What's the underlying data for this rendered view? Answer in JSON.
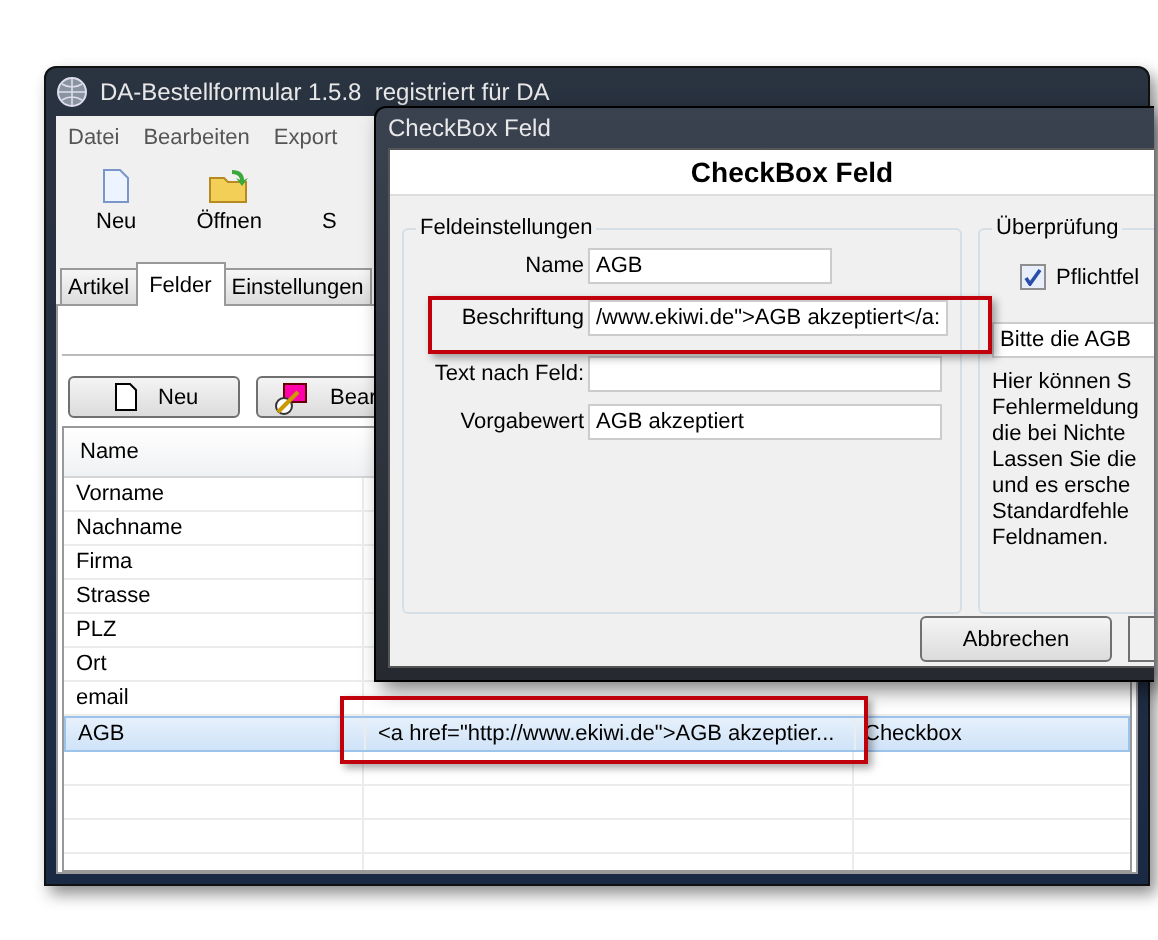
{
  "main_window": {
    "title": "DA-Bestellformular 1.5.8  registriert für DA",
    "menu": [
      "Datei",
      "Bearbeiten",
      "Export"
    ],
    "toolbar": [
      "Neu",
      "Öffnen",
      "S"
    ],
    "tabs": [
      {
        "label": "Artikel",
        "selected": false
      },
      {
        "label": "Felder",
        "selected": true
      },
      {
        "label": "Einstellungen",
        "selected": false
      }
    ],
    "buttons": [
      "Neu",
      "Bear"
    ],
    "table": {
      "columns": [
        "Name"
      ],
      "rows": [
        {
          "cells": [
            "Vorname"
          ],
          "selected": false
        },
        {
          "cells": [
            "Nachname"
          ],
          "selected": false
        },
        {
          "cells": [
            "Firma"
          ],
          "selected": false
        },
        {
          "cells": [
            "Strasse"
          ],
          "selected": false
        },
        {
          "cells": [
            "PLZ"
          ],
          "selected": false
        },
        {
          "cells": [
            "Ort"
          ],
          "selected": false
        },
        {
          "cells": [
            "email"
          ],
          "selected": false
        },
        {
          "cells": [
            "AGB",
            "<a href=\"http://www.ekiwi.de\">AGB akzeptier...",
            "Checkbox"
          ],
          "selected": true
        }
      ]
    }
  },
  "dialog": {
    "title": "CheckBox Feld",
    "heading": "CheckBox Feld",
    "settings": {
      "legend": "Feldeinstellungen",
      "fields": [
        {
          "label": "Name",
          "value": "AGB"
        },
        {
          "label": "Beschriftung",
          "value": "/www.ekiwi.de\">AGB akzeptiert</a:"
        },
        {
          "label": "Text nach Feld:"
        },
        {
          "label": "Vorgabewert",
          "value": "AGB akzeptiert"
        }
      ]
    },
    "validation": {
      "legend": "Überprüfung",
      "required": {
        "label": "Pflichtfel",
        "checked": true
      },
      "message": "Bitte die AGB",
      "help_lines": [
        "Hier können S",
        "Fehlermeldung",
        "die bei Nichte",
        "Lassen Sie die",
        "und es ersche",
        "Standardfehle",
        "Feldnamen."
      ]
    },
    "buttons": [
      "Abbrechen"
    ]
  }
}
